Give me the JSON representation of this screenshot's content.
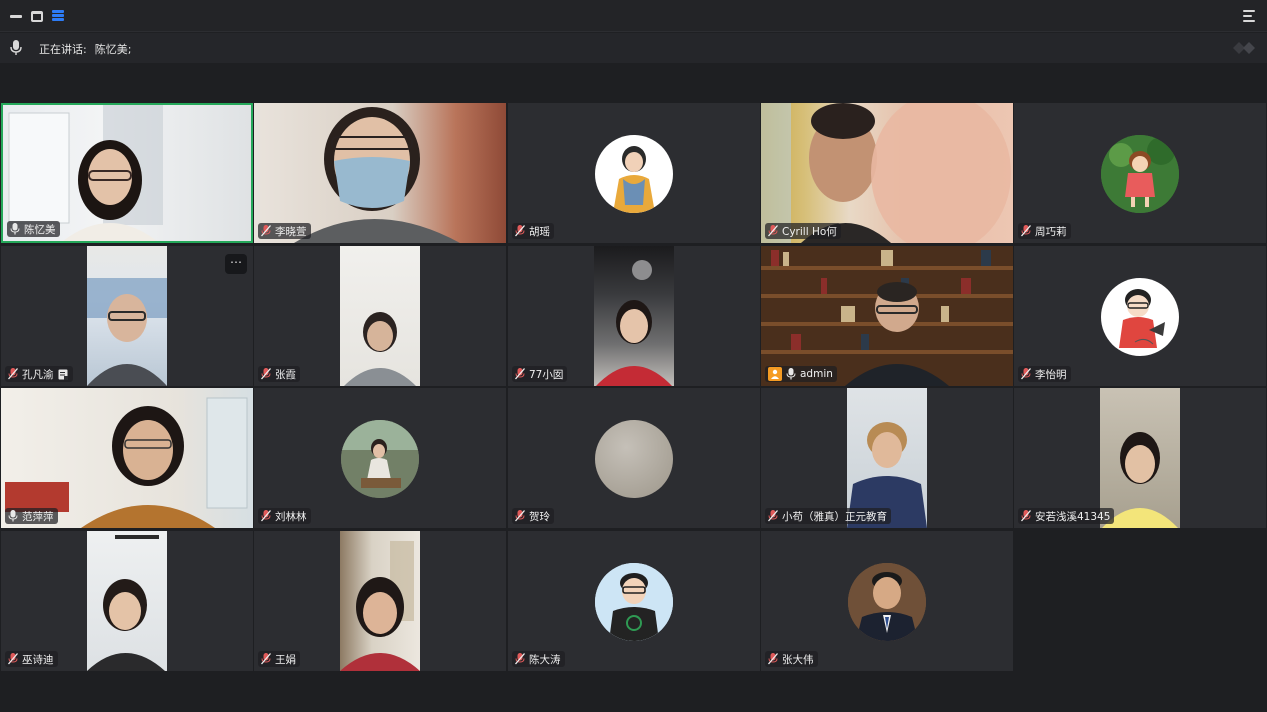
{
  "window": {
    "buttons": [
      {
        "name": "minimize-button"
      },
      {
        "name": "maximize-button"
      },
      {
        "name": "layout-grid-button"
      }
    ]
  },
  "speaker_bar": {
    "label": "正在讲话:",
    "speaker": "陈忆美;"
  },
  "colors": {
    "active_speaker_border": "#25a85a",
    "tile_background": "#2c2d31",
    "muted_mic": "#e05a5a",
    "host_badge": "#f59b23",
    "layout_icon": "#2d7cf6"
  },
  "participants": [
    {
      "name": "陈忆美",
      "mic": "on",
      "active": true,
      "media": "camera"
    },
    {
      "name": "李晓萱",
      "mic": "muted",
      "media": "camera"
    },
    {
      "name": "胡瑶",
      "mic": "muted",
      "media": "avatar"
    },
    {
      "name": "Cyrill Ho何",
      "mic": "muted",
      "media": "camera"
    },
    {
      "name": "周巧莉",
      "mic": "muted",
      "media": "avatar"
    },
    {
      "name": "孔凡渝",
      "mic": "muted",
      "media": "camera",
      "extra_icon": "shared-note-icon",
      "more_menu": "⋯"
    },
    {
      "name": "张霞",
      "mic": "muted",
      "media": "camera"
    },
    {
      "name": "77小囡",
      "mic": "muted",
      "media": "camera"
    },
    {
      "name": "admin",
      "mic": "on",
      "host": true,
      "media": "camera"
    },
    {
      "name": "李怡明",
      "mic": "muted",
      "media": "avatar"
    },
    {
      "name": "范萍萍",
      "mic": "on",
      "media": "camera"
    },
    {
      "name": "刘林林",
      "mic": "muted",
      "media": "avatar"
    },
    {
      "name": "贺玲",
      "mic": "muted",
      "media": "avatar"
    },
    {
      "name": "小苟（雅真）正元教育",
      "mic": "muted",
      "media": "camera"
    },
    {
      "name": "安若浅溪41345",
      "mic": "muted",
      "media": "camera"
    },
    {
      "name": "巫诗迪",
      "mic": "muted",
      "media": "camera"
    },
    {
      "name": "王娟",
      "mic": "muted",
      "media": "camera"
    },
    {
      "name": "陈大涛",
      "mic": "muted",
      "media": "avatar"
    },
    {
      "name": "张大伟",
      "mic": "muted",
      "media": "avatar"
    }
  ]
}
